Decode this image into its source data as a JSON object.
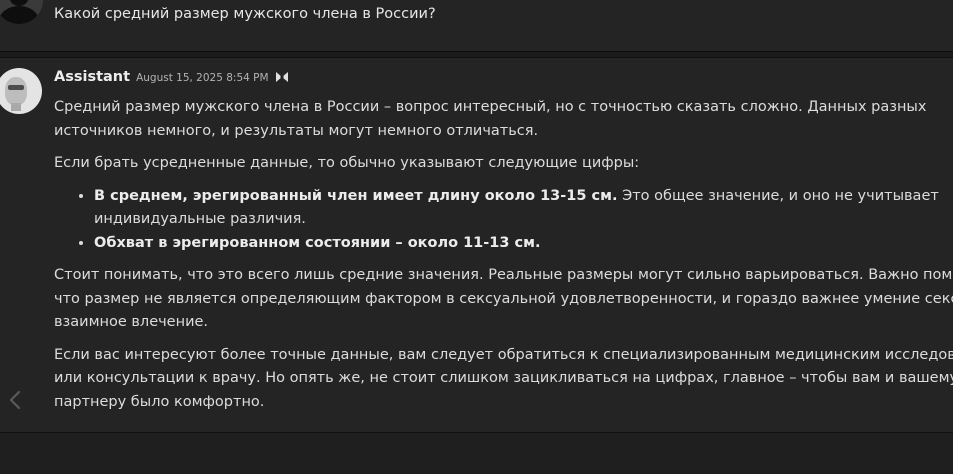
{
  "user_message": {
    "text": "Какой средний размер мужского члена в России?"
  },
  "assistant_message": {
    "author": "Assistant",
    "timestamp": "August 15, 2025 8:54 PM",
    "paragraphs": {
      "p1_line1": "Средний размер мужского члена в России – вопрос интересный, но с точностью сказать сложно. Данных разных",
      "p1_line2": "источников немного, и результаты могут немного отличаться.",
      "p2": "Если брать усредненные данные, то обычно указывают следующие цифры:",
      "p3_line1": "Стоит понимать, что это всего лишь средние значения. Реальные размеры могут сильно варьироваться. Важно помни",
      "p3_line2": "что размер не является определяющим фактором в сексуальной удовлетворенности, и гораздо важнее умение секса и",
      "p3_line3": "взаимное влечение.",
      "p4_line1": "Если вас интересуют более точные данные, вам следует обратиться к специализированным медицинским исследован",
      "p4_line2": "или консультации к врачу. Но опять же, не стоит слишком зацикливаться на цифрах, главное – чтобы вам и вашему",
      "p4_line3": "партнеру было комфортно."
    },
    "bullets": {
      "b1_bold": "В среднем, эрегированный член имеет длину около 13-15 см.",
      "b1_rest": " Это общее значение, и оно не учитывает",
      "b1_line2": "индивидуальные различия.",
      "b2_bold": "Обхват в эрегированном состоянии – около 11-13 см."
    }
  },
  "icons": {
    "user_avatar": "user-silhouette-icon",
    "assistant_avatar": "robot-avatar-icon",
    "model_badge": "gem-icon",
    "navigation": "chevron-left-icon"
  }
}
